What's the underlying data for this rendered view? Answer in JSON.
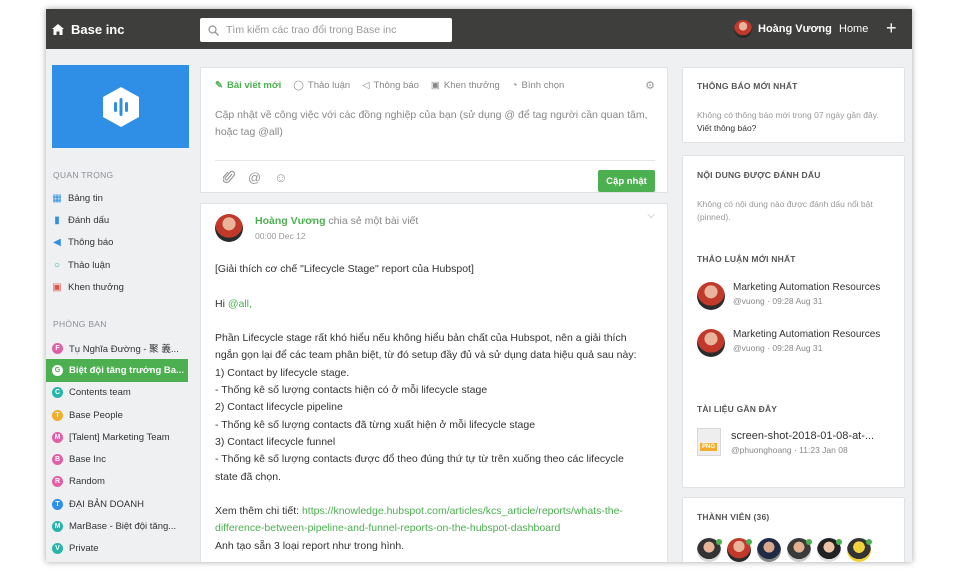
{
  "topbar": {
    "brand": "Base inc",
    "search_placeholder": "Tìm kiếm các trao đổi trong Base inc",
    "user_name": "Hoàng Vương",
    "home_label": "Home",
    "plus_label": "+"
  },
  "sidebar": {
    "important_title": "QUAN TRỌNG",
    "important_items": [
      {
        "label": "Bảng tin",
        "icon": "grid-icon"
      },
      {
        "label": "Đánh dấu",
        "icon": "bookmark-icon"
      },
      {
        "label": "Thông báo",
        "icon": "megaphone-icon"
      },
      {
        "label": "Thảo luận",
        "icon": "chat-bubble-icon"
      },
      {
        "label": "Khen thưởng",
        "icon": "gift-icon"
      }
    ],
    "groups_title": "PHÒNG BAN",
    "groups": [
      {
        "letter": "F",
        "label": "Tụ Nghĩa Đường - 聚 義...",
        "color": "#e05fa6"
      },
      {
        "letter": "G",
        "label": "Biệt đội tăng trưởng Ba...",
        "color": "#4caf50",
        "active": true
      },
      {
        "letter": "C",
        "label": "Contents team",
        "color": "#26b5a8"
      },
      {
        "letter": "T",
        "label": "Base People",
        "color": "#f0ad2e"
      },
      {
        "letter": "M",
        "label": "[Talent] Marketing Team",
        "color": "#e05fa6"
      },
      {
        "letter": "B",
        "label": "Base Inc",
        "color": "#e05fa6"
      },
      {
        "letter": "R",
        "label": "Random",
        "color": "#e05fa6"
      },
      {
        "letter": "T",
        "label": "ĐẠI BẢN DOANH",
        "color": "#2f8fe6"
      },
      {
        "letter": "M",
        "label": "MarBase - Biệt đội tăng...",
        "color": "#26b5a8"
      },
      {
        "letter": "V",
        "label": "Private",
        "color": "#26b5a8"
      }
    ]
  },
  "composer": {
    "tabs": [
      {
        "label": "Bài viết mới",
        "icon": "edit-icon",
        "active": true
      },
      {
        "label": "Thảo luận",
        "icon": "chat-bubble-icon"
      },
      {
        "label": "Thông báo",
        "icon": "megaphone-icon"
      },
      {
        "label": "Khen thưởng",
        "icon": "gift-icon"
      },
      {
        "label": "Bình chọn",
        "icon": "poll-icon"
      }
    ],
    "placeholder": "Cập nhật về công việc với các đồng nghiệp của bạn (sử dụng @ để tag người cần quan tâm, hoặc tag @all)",
    "submit_label": "Cập nhật"
  },
  "post": {
    "author": "Hoàng Vương",
    "action": "chia sẻ một bài viết",
    "time": "00:00 Dec 12",
    "title_line": "[Giải thích cơ chế \"Lifecycle Stage\" report của Hubspot]",
    "greeting": "Hi",
    "mention": "@all,",
    "body_lines": [
      "Phần Lifecycle stage rất khó hiểu nếu không hiểu bản chất của Hubspot, nên a giải thích",
      "ngắn gọn lại để các team phân biệt, từ đó setup đầy đủ và sử dụng data hiệu quả sau này:",
      "1) Contact by lifecycle stage.",
      "- Thống kê số lượng contacts hiện có ở mỗi lifecycle stage",
      "2) Contact lifecycle pipeline",
      "- Thống kê số lượng contacts đã từng xuất hiện ở mỗi lifecycle stage",
      "3) Contact lifecycle funnel",
      "- Thống kê số lượng contacts được đổ theo đúng thứ tự từ trên xuống theo các lifecycle",
      "state đã chọn."
    ],
    "more_prefix": "Xem thêm chi tiết:",
    "link_line1": "https://knowledge.hubspot.com/articles/kcs_article/reports/whats-the-",
    "link_line2": "difference-between-pipeline-and-funnel-reports-on-the-hubspot-dashboard",
    "last_line": "Anh tạo sẵn 3 loại report như trong hình."
  },
  "right": {
    "notif_title": "THÔNG BÁO MỚI NHẤT",
    "notif_empty": "Không có thông báo mới trong 07 ngày gần đây.",
    "notif_link": "Viết thông báo?",
    "pinned_title": "NỘI DUNG ĐƯỢC ĐÁNH DẤU",
    "pinned_empty": "Không có nội dung nào được đánh dấu nổi bật (pinned).",
    "discuss_title": "THẢO LUẬN MỚI NHẤT",
    "discussions": [
      {
        "title": "Marketing Automation Resources",
        "meta": "@vuong · 09:28 Aug 31"
      },
      {
        "title": "Marketing Automation Resources",
        "meta": "@vuong · 09:28 Aug 31"
      }
    ],
    "docs_title": "TÀI LIỆU GẦN ĐÂY",
    "doc_name": "screen-shot-2018-01-08-at-...",
    "doc_badge": "PNG",
    "doc_meta": "@phuonghoang · 11:23 Jan 08",
    "members_title": "THÀNH VIÊN (36)"
  }
}
